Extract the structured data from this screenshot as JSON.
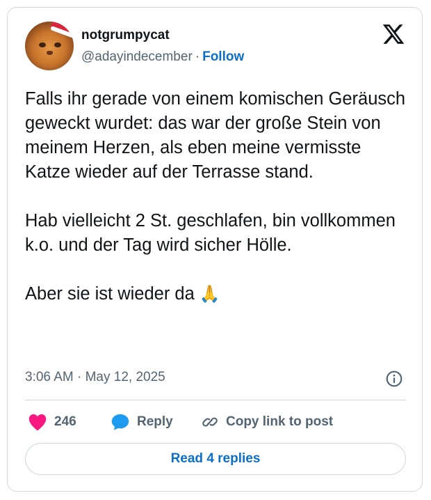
{
  "author": {
    "display_name": "notgrumpycat",
    "handle": "@adayindecember",
    "separator": "·",
    "follow_label": "Follow"
  },
  "tweet": {
    "paragraphs": [
      "Falls ihr gerade von einem komischen Geräusch geweckt wurdet: das war der große Stein von meinem Herzen, als eben meine vermisste Katze wieder auf der Terrasse stand.",
      "Hab vielleicht 2 St. geschlafen, bin vollkommen k.o. und der Tag wird sicher Hölle.",
      "Aber sie ist wieder da"
    ],
    "emoji": "🙏",
    "timestamp": "3:06 AM · May 12, 2025"
  },
  "actions": {
    "like_count": "246",
    "reply_label": "Reply",
    "copy_link_label": "Copy link to post"
  },
  "read_replies_label": "Read 4 replies",
  "colors": {
    "accent": "#0b6ec7",
    "like": "#f91880",
    "reply_icon": "#1d9bf0",
    "secondary_text": "#536471",
    "border": "#cfd9de"
  },
  "icons": [
    "x-logo-icon",
    "info-icon",
    "heart-icon",
    "reply-bubble-icon",
    "link-icon"
  ]
}
